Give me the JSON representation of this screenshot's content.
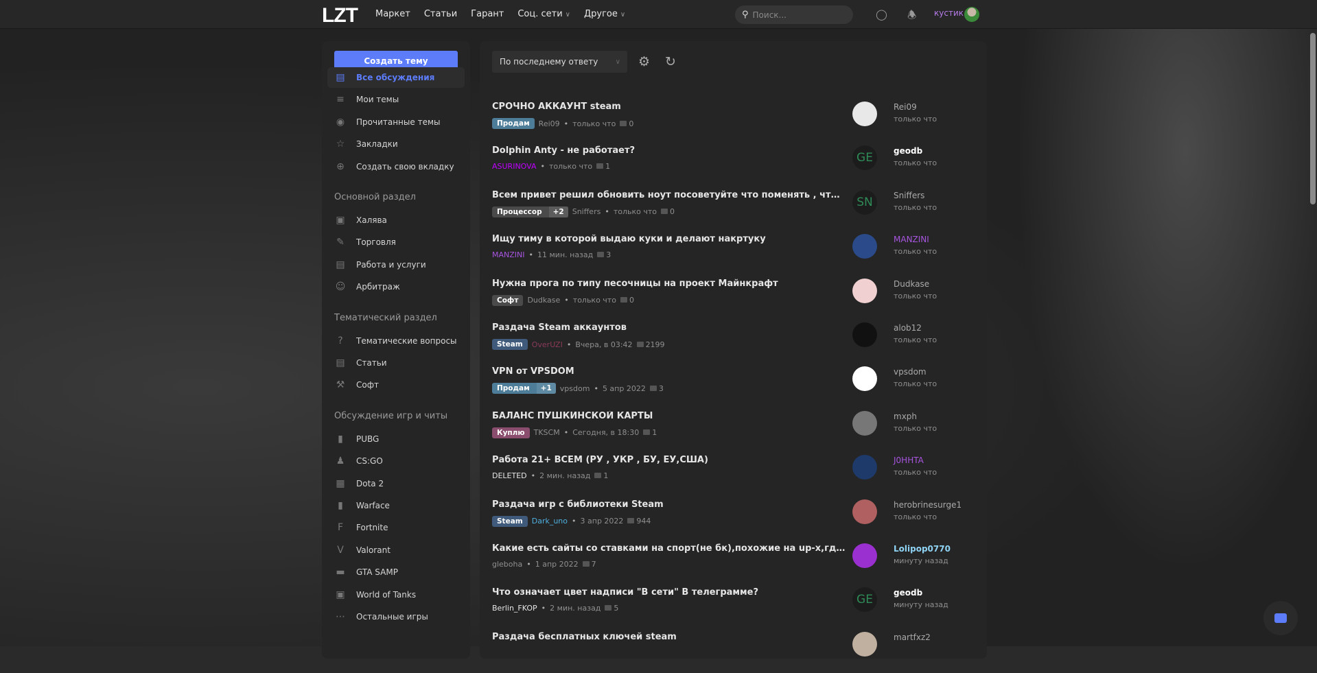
{
  "header": {
    "logo": "LZT",
    "nav": [
      {
        "label": "Маркет"
      },
      {
        "label": "Статьи"
      },
      {
        "label": "Гарант"
      },
      {
        "label": "Соц. сети",
        "dropdown": true
      },
      {
        "label": "Другое",
        "dropdown": true
      }
    ],
    "search_placeholder": "Поиск...",
    "username": "кустик"
  },
  "sidebar": {
    "create_label": "Создать тему",
    "top": [
      {
        "label": "Все обсуждения",
        "icon": "chat-icon",
        "active": true
      },
      {
        "label": "Мои темы",
        "icon": "list-icon"
      },
      {
        "label": "Прочитанные темы",
        "icon": "eye-icon"
      },
      {
        "label": "Закладки",
        "icon": "star-icon"
      },
      {
        "label": "Создать свою вкладку",
        "icon": "plus-circle-icon"
      }
    ],
    "sections": [
      {
        "title": "Основной раздел",
        "items": [
          {
            "label": "Халява",
            "icon": "gift-icon"
          },
          {
            "label": "Торговля",
            "icon": "tag-icon"
          },
          {
            "label": "Работа и услуги",
            "icon": "clipboard-icon"
          },
          {
            "label": "Арбитраж",
            "icon": "user-icon"
          }
        ]
      },
      {
        "title": "Тематический раздел",
        "items": [
          {
            "label": "Тематические вопросы",
            "icon": "question-icon"
          },
          {
            "label": "Статьи",
            "icon": "document-icon"
          },
          {
            "label": "Софт",
            "icon": "wrench-icon"
          }
        ]
      },
      {
        "title": "Обсуждение игр и читы",
        "items": [
          {
            "label": "PUBG",
            "icon": "pubg-icon"
          },
          {
            "label": "CS:GO",
            "icon": "csgo-icon"
          },
          {
            "label": "Dota 2",
            "icon": "dota-icon"
          },
          {
            "label": "Warface",
            "icon": "warface-icon"
          },
          {
            "label": "Fortnite",
            "icon": "fortnite-icon"
          },
          {
            "label": "Valorant",
            "icon": "valorant-icon"
          },
          {
            "label": "GTA SAMP",
            "icon": "gta-icon"
          },
          {
            "label": "World of Tanks",
            "icon": "tank-icon"
          },
          {
            "label": "Остальные игры",
            "icon": "dots-icon"
          }
        ]
      }
    ]
  },
  "main": {
    "sort_label": "По последнему ответу",
    "threads": [
      {
        "title": "СРОЧНО АККАУНТ steam",
        "tag": "Продам",
        "tag_color": "#4d7d99",
        "author": "Rei09",
        "author_color": "#8f8f8f",
        "time": "только что",
        "replies": "0",
        "last_user": "Rei09",
        "last_color": "#aaaaaa",
        "last_time": "только что",
        "avatar": "photo"
      },
      {
        "title": "Dolphin Anty - не работает?",
        "author": "ASURINOVA",
        "author_color": "#c000ff",
        "time": "только что",
        "replies": "1",
        "last_user": "geodb",
        "last_color": "#ffffff",
        "last_bold": true,
        "last_time": "только что",
        "avatar": "GE"
      },
      {
        "title": "Всем привет решил обновить ноут посоветуйте что поменять , чтобы форт па...",
        "tag": "Процессор",
        "tag_extra": "+2",
        "tag_color": "#4a4a4a",
        "author": "Sniffers",
        "author_color": "#8f8f8f",
        "time": "только что",
        "replies": "0",
        "last_user": "Sniffers",
        "last_color": "#aaaaaa",
        "last_time": "только что",
        "avatar": "SN"
      },
      {
        "title": "Ищу тиму в которой выдаю куки и делают накртуку",
        "author": "MANZINI",
        "author_color": "#a855e0",
        "time": "11 мин. назад",
        "replies": "3",
        "last_user": "MANZINI",
        "last_color": "#a855e0",
        "last_time": "только что",
        "avatar": "photo"
      },
      {
        "title": "Нужна прога по типу песочницы на проект Майнкрафт",
        "tag": "Софт",
        "tag_color": "#4a4a4a",
        "author": "Dudkase",
        "author_color": "#8f8f8f",
        "time": "только что",
        "replies": "0",
        "last_user": "Dudkase",
        "last_color": "#aaaaaa",
        "last_time": "только что",
        "avatar": "photo"
      },
      {
        "title": "Раздача Steam аккаунтов",
        "tag": "Steam",
        "tag_color": "#3f5a7a",
        "author": "OverUZI",
        "author_color": "#8a3a5a",
        "time": "Вчера, в 03:42",
        "replies": "2199",
        "last_user": "alob12",
        "last_color": "#aaaaaa",
        "last_time": "только что",
        "avatar": "photo"
      },
      {
        "title": "VPN от VPSDOM",
        "tag": "Продам",
        "tag_extra": "+1",
        "tag_color": "#4d7d99",
        "author": "vpsdom",
        "author_color": "#8f8f8f",
        "time": "5 апр 2022",
        "replies": "3",
        "last_user": "vpsdom",
        "last_color": "#aaaaaa",
        "last_time": "только что",
        "avatar": "photo"
      },
      {
        "title": "БАЛАНС ПУШКИНСКОЙ КАРТЫ",
        "tag": "Куплю",
        "tag_color": "#8a4d6e",
        "author": "TKSCM",
        "author_color": "#8f8f8f",
        "time": "Сегодня, в 18:30",
        "replies": "1",
        "last_user": "mxph",
        "last_color": "#aaaaaa",
        "last_time": "только что",
        "avatar": "photo"
      },
      {
        "title": "Работа 21+ ВСЕМ (РУ , УКР , БУ, ЕУ,США)",
        "author": "DELETED",
        "author_color": "#e6e6e6",
        "time": "2 мин. назад",
        "replies": "1",
        "last_user": "J0HHTA",
        "last_color": "#a855e0",
        "last_time": "только что",
        "avatar": "photo"
      },
      {
        "title": "Раздача игр с библиотеки Steam",
        "tag": "Steam",
        "tag_color": "#3f5a7a",
        "author": "Dark_uno",
        "author_color": "#4fb0e0",
        "time": "3 апр 2022",
        "replies": "944",
        "last_user": "herobrinesurge1",
        "last_color": "#aaaaaa",
        "last_time": "только что",
        "avatar": "photo"
      },
      {
        "title": "Какие есть сайты со ставками на спорт(не бк),похожие на up-x,где есть раздел ...",
        "author": "gleboha",
        "author_color": "#8f8f8f",
        "time": "1 апр 2022",
        "replies": "7",
        "last_user": "Lolipop0770",
        "last_color": "#8fd3f5",
        "last_bold": true,
        "last_time": "минуту назад",
        "avatar": "photo"
      },
      {
        "title": "Что означает цвет надписи \"В сети\" В телеграмме?",
        "author": "Berlin_FKOP",
        "author_color": "#e6e6e6",
        "time": "2 мин. назад",
        "replies": "5",
        "last_user": "geodb",
        "last_color": "#ffffff",
        "last_bold": true,
        "last_time": "минуту назад",
        "avatar": "GE"
      },
      {
        "title": "Раздача бесплатных ключей steam",
        "last_user": "martfxz2",
        "last_color": "#aaaaaa",
        "avatar": "photo"
      }
    ]
  },
  "colors": {
    "accent": "#5c7cfa",
    "background": "#252525"
  }
}
